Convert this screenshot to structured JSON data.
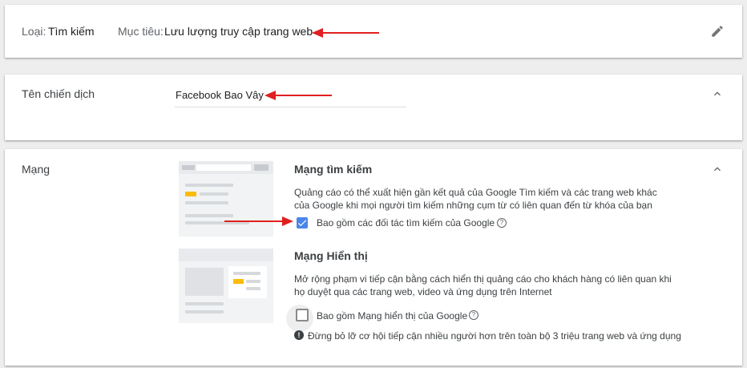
{
  "type_card": {
    "type_label": "Loại:",
    "type_value": "Tìm kiếm",
    "goal_label": "Mục tiêu:",
    "goal_value": "Lưu lượng truy cập trang web",
    "edit_icon": "pencil-icon"
  },
  "name_card": {
    "label": "Tên chiến dịch",
    "value": "Facebook Bao Vây",
    "collapse_icon": "chevron-up-icon"
  },
  "network_card": {
    "label": "Mạng",
    "collapse_icon": "chevron-up-icon",
    "search": {
      "title": "Mạng tìm kiếm",
      "description": "Quảng cáo có thể xuất hiện gần kết quả của Google Tìm kiếm và các trang web khác của Google khi mọi người tìm kiếm những cụm từ có liên quan đến từ khóa của bạn",
      "checkbox_label": "Bao gồm các đối tác tìm kiếm của Google",
      "checked": true
    },
    "display": {
      "title": "Mạng Hiển thị",
      "description": "Mở rộng phạm vi tiếp cận bằng cách hiển thị quảng cáo cho khách hàng có liên quan khi họ duyệt qua các trang web, video và ứng dụng trên Internet",
      "checkbox_label": "Bao gồm Mạng hiển thị của Google",
      "checked": false,
      "info_text": "Đừng bỏ lỡ cơ hội tiếp cận nhiều người hơn trên toàn bộ 3 triệu trang web và ứng dụng"
    }
  },
  "colors": {
    "arrow": "#e02020",
    "checkbox": "#4a86e8",
    "highlight": "#fbbc04"
  }
}
